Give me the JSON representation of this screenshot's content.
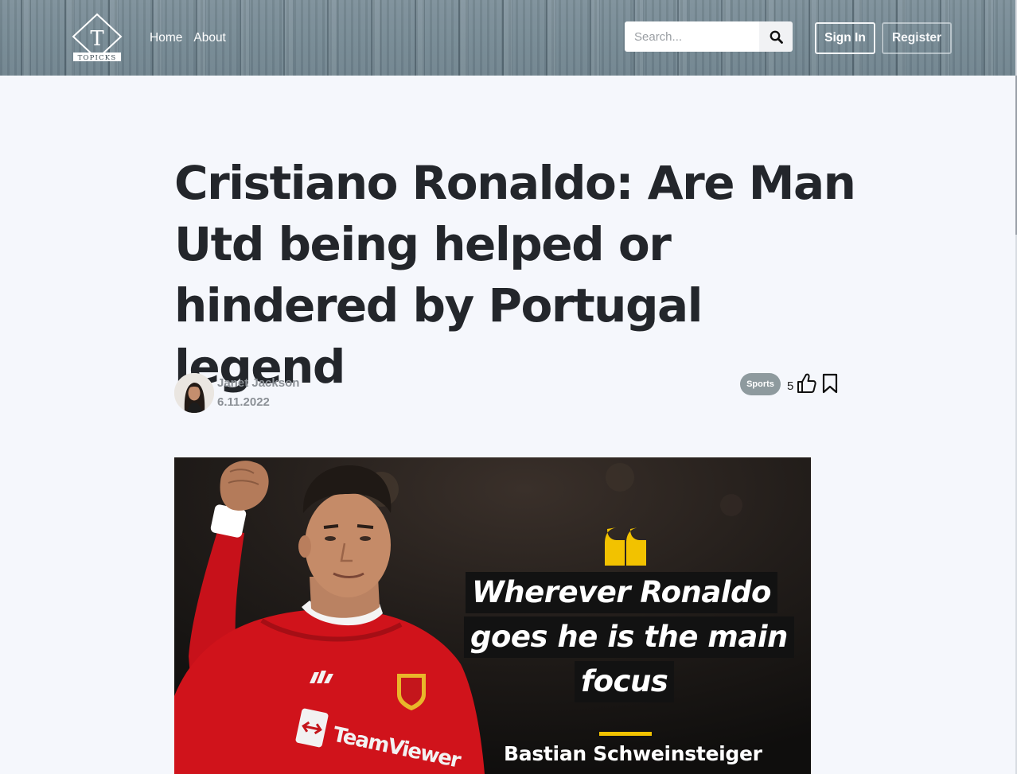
{
  "header": {
    "logo": {
      "letter": "T",
      "text": "TOPICKS"
    },
    "nav": [
      {
        "label": "Home"
      },
      {
        "label": "About"
      }
    ],
    "search": {
      "placeholder": "Search...",
      "icon": "search-icon"
    },
    "sign_in_label": "Sign In",
    "register_label": "Register"
  },
  "article": {
    "title": "Cristiano Ronaldo: Are Man Utd being helped or hindered by Portugal legend",
    "author": {
      "name": "Janet Jackson",
      "date": "6.11.2022"
    },
    "tag": "Sports",
    "likes": "5",
    "hero": {
      "quote_lines": [
        "Wherever Ronaldo",
        "goes he is the main",
        "focus"
      ],
      "quote_author": "Bastian Schweinsteiger",
      "shirt_text": "TeamViewer"
    }
  },
  "colors": {
    "navbar": "#768a94",
    "page_bg": "#f5f7fc",
    "title": "#23262b",
    "meta": "#8b9096",
    "badge": "#8e9a9e",
    "quote_mark": "#f2c200",
    "shirt_red": "#d0131b"
  }
}
